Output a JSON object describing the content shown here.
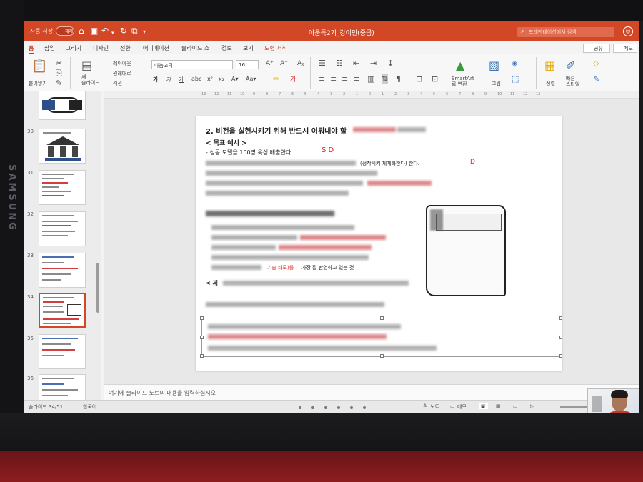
{
  "brand": "SAMSUNG",
  "titlebar": {
    "autosave_label": "자동 저장",
    "autosave_state": "해제",
    "document_title": "아운득2기_강이민(중급)",
    "search_placeholder": "프레젠테이션에서 검색"
  },
  "menu": {
    "items": [
      "홈",
      "삽입",
      "그리기",
      "디자인",
      "전환",
      "애니메이션",
      "슬라이드 쇼",
      "검토",
      "보기",
      "도형 서식"
    ],
    "share_label": "공유",
    "note_label": "메모"
  },
  "ribbon": {
    "paste": "붙여넣기",
    "new_slide": "새\n슬라이드",
    "layout": "레이아웃",
    "reset": "원래대로",
    "section": "섹션",
    "font_name": "나눔고딕",
    "font_size": "16",
    "smartart": "SmartArt\n로 변환",
    "picture": "그림",
    "arrange": "정렬",
    "quick_styles": "빠른\n스타일"
  },
  "ruler_ticks": [
    "13",
    "12",
    "11",
    "10",
    "9",
    "8",
    "7",
    "6",
    "5",
    "4",
    "3",
    "2",
    "1",
    "0",
    "1",
    "2",
    "3",
    "4",
    "5",
    "6",
    "7",
    "8",
    "9",
    "10",
    "11",
    "12",
    "13"
  ],
  "thumbnails": [
    {
      "num": "",
      "selected": false
    },
    {
      "num": "30",
      "selected": false
    },
    {
      "num": "31",
      "selected": false
    },
    {
      "num": "32",
      "selected": false
    },
    {
      "num": "33",
      "selected": false
    },
    {
      "num": "34",
      "selected": true
    },
    {
      "num": "35",
      "selected": false
    },
    {
      "num": "36",
      "selected": false
    }
  ],
  "slide": {
    "title": "2. 비전을 실현시키기 위해 반드시 이뤄내야 할",
    "subtitle": "< 목표 예시 >",
    "bullet1": "- 성공 모델을 100명 육성 배출한다.",
    "line_fragment": "(정착시켜 체계화한다) 한다.",
    "red_fragment": "기술 태도)를",
    "dark_fragment": "가장 잘 반영하고 있는 것",
    "section2_prefix": "< 제",
    "note_marks": "D",
    "note_marks2": "S D"
  },
  "notes_placeholder": "여기에 슬라이드 노트의 내용을 입력하십시오",
  "status": {
    "slide_counter": "슬라이드 34/51",
    "language": "한국어",
    "notes_btn": "노트",
    "comments_btn": "메모"
  },
  "colors": {
    "accent": "#d24726",
    "selection": "#d24726"
  }
}
